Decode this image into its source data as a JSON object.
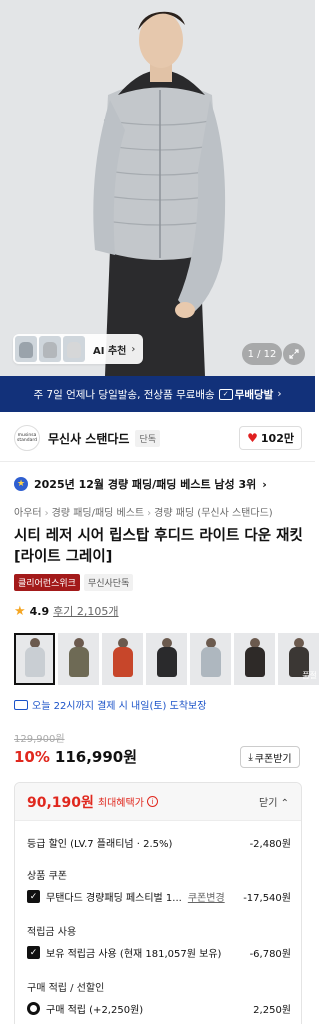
{
  "hero": {
    "ai_label": "AI 추천",
    "counter": "1 / 12"
  },
  "ship_banner": {
    "text": "주 7일 언제나 당일발송, 전상품 무료배송",
    "badge": "무배당발"
  },
  "brand": {
    "logo_line1": "musinsa",
    "logo_line2": "standard",
    "name": "무신사 스탠다드",
    "tag": "단독",
    "likes": "102만"
  },
  "rank": {
    "text": "2025년 12월 경량 패딩/패딩 베스트 남성 3위"
  },
  "breadcrumb": [
    "아우터",
    "경량 패딩/패딩 베스트",
    "경량 패딩 (무신사 스탠다드)"
  ],
  "product": {
    "title": "시티 레저 시어 립스탑 후디드 라이트 다운 재킷 [라이트 그레이]",
    "tag_red": "클리어런스위크",
    "tag_gray": "무신사단독",
    "rating": "4.9",
    "reviews": "후기 2,105개"
  },
  "thumbnails": [
    {
      "color": "#c9ced3"
    },
    {
      "color": "#6e6a55"
    },
    {
      "color": "#c7462a"
    },
    {
      "color": "#2a2a2c"
    },
    {
      "color": "#aeb7bf"
    },
    {
      "color": "#2e2a28"
    },
    {
      "color": "#3b3734",
      "more": "품절"
    }
  ],
  "delivery": {
    "text": "오늘 22시까지 결제 시 내일(토) 도착보장"
  },
  "price": {
    "original": "129,900원",
    "discount": "10%",
    "current": "116,990원",
    "coupon_button": "쿠폰받기"
  },
  "benefit": {
    "max_price": "90,190원",
    "max_label": "최대혜택가",
    "close": "닫기",
    "grade_label": "등급 할인 (LV.7 플래티넘 · 2.5%)",
    "grade_amount": "-2,480원",
    "coupon_section": "상품 쿠폰",
    "coupon_label": "무탠다드 경량패딩 페스티벌 1...",
    "coupon_change": "쿠폰변경",
    "coupon_amount": "-17,540원",
    "points_section": "적립금 사용",
    "points_label": "보유 적립금 사용 (현재 181,057원 보유)",
    "points_amount": "-6,780원",
    "earn_section": "구매 적립 / 선할인",
    "earn_label": "구매 적립 (+2,250원)",
    "earn_amount": "2,250원"
  },
  "colors": {
    "banner": "#12317a",
    "accent_red": "#e0281e",
    "delivery_blue": "#1a52c8"
  }
}
